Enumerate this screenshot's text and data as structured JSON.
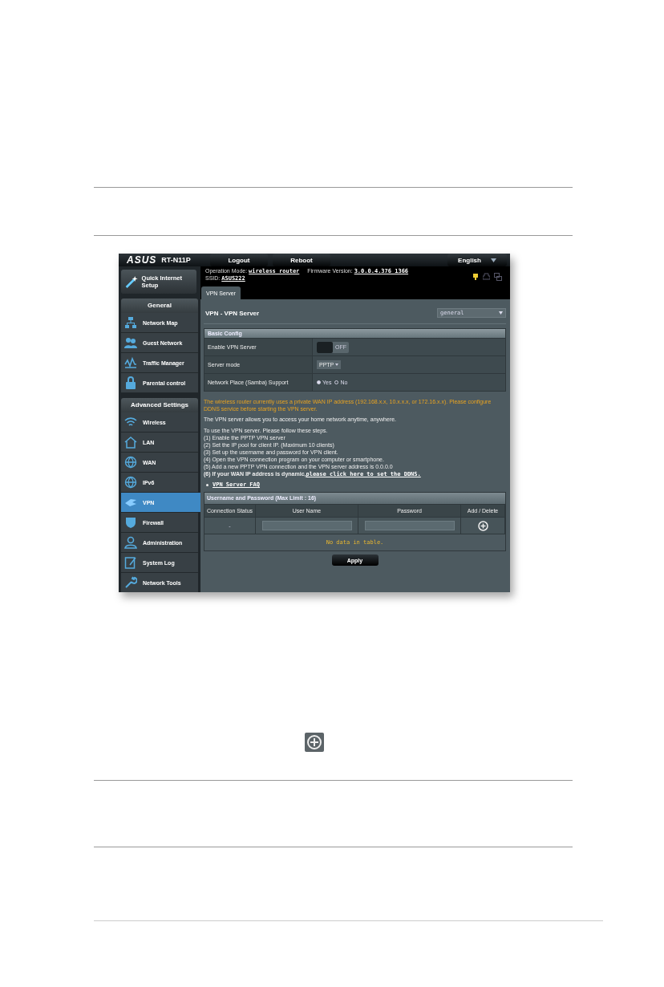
{
  "router": {
    "logo": "ASUS",
    "model": "RT-N11P",
    "top_buttons": [
      "Logout",
      "Reboot"
    ],
    "language": "English",
    "operation_mode_label": "Operation Mode:",
    "operation_mode": "wireless router",
    "firmware_label": "Firmware Version:",
    "firmware": "3.0.0.4.376_1366",
    "ssid_label": "SSID:",
    "ssid": "ASUS222",
    "quick_setup": "Quick Internet Setup",
    "sidebar": [
      {
        "heading": "General",
        "items": [
          {
            "label": "Network Map",
            "selected": false
          },
          {
            "label": "Guest Network",
            "selected": false
          },
          {
            "label": "Traffic Manager",
            "selected": false
          },
          {
            "label": "Parental control",
            "selected": false
          }
        ]
      },
      {
        "heading": "Advanced Settings",
        "items": [
          {
            "label": "Wireless",
            "selected": false
          },
          {
            "label": "LAN",
            "selected": false
          },
          {
            "label": "WAN",
            "selected": false
          },
          {
            "label": "IPv6",
            "selected": false
          },
          {
            "label": "VPN",
            "selected": true
          },
          {
            "label": "Firewall",
            "selected": false
          },
          {
            "label": "Administration",
            "selected": false
          },
          {
            "label": "System Log",
            "selected": false
          },
          {
            "label": "Network Tools",
            "selected": false
          }
        ]
      }
    ],
    "tabs": [
      {
        "label": "VPN Server",
        "selected": true
      }
    ],
    "title": "VPN - VPN Server",
    "profile": "general",
    "basic_config": {
      "heading": "Basic Config",
      "rows": [
        {
          "kind": "toggle",
          "label": "Enable VPN Server",
          "on": false,
          "value": "OFF"
        },
        {
          "kind": "select",
          "label": "Server mode",
          "value": "PPTP"
        },
        {
          "kind": "radio",
          "label": "Network Place (Samba) Support",
          "options": [
            {
              "label": "Yes",
              "selected": true
            },
            {
              "label": "No",
              "selected": false
            }
          ]
        }
      ]
    },
    "warning": "The wireless router currently uses a private WAN IP address (192.168.x.x, 10.x.x.x, or 172.16.x.x). Please configure DDNS service before starting the VPN server.",
    "intro": "The VPN server allows you to access your home network anytime, anywhere.",
    "steps_heading": "To use the VPN server. Please follow these steps.",
    "steps": [
      "(1) Enable the PPTP VPN server",
      "(2) Set the IP pool for client IP. (Maximum 10 clients)",
      "(3) Set up the username and password for VPN client.",
      "(4) Open the VPN connection program on your computer or smartphone.",
      "(5) Add a new PPTP VPN connection and the VPN server address is 0.0.0.0"
    ],
    "dynamic_note": "(6) If your WAN IP address is dynamic,",
    "ddns_link": "please click here to set the DDNS.",
    "faq_link": "VPN Server FAQ",
    "users": {
      "heading": "Username and Password (Max Limit : 16)",
      "columns": [
        "Connection Status",
        "User Name",
        "Password",
        "Add / Delete"
      ],
      "status": "-",
      "empty": "No data in table."
    },
    "apply": "Apply"
  }
}
